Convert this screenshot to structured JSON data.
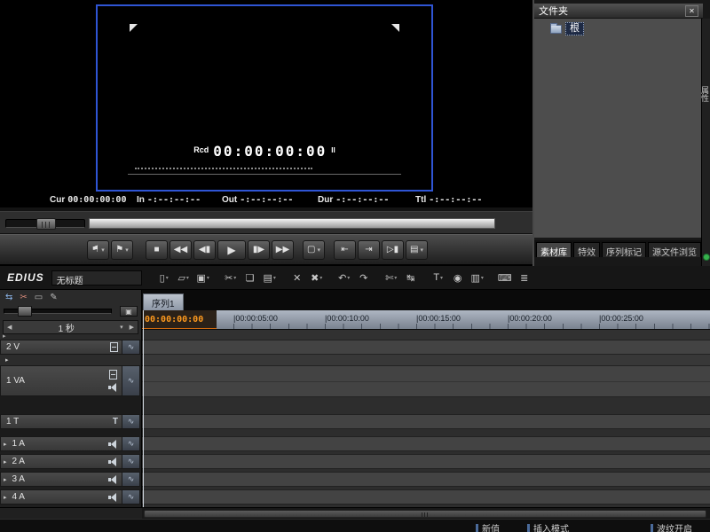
{
  "app": {
    "logo": "EDIUS",
    "project_title": "无标题"
  },
  "ui": {
    "dd": "▾",
    "left_arrow": "◀",
    "right_arrow": "▶",
    "expander": "▸"
  },
  "player": {
    "rcd_label": "Rcd",
    "rcd_timecode": "00:00:00:00",
    "pause_glyph": "II",
    "status": [
      {
        "label": "Cur",
        "value": "00:00:00:00"
      },
      {
        "label": "In",
        "value": "-:--:--:--"
      },
      {
        "label": "Out",
        "value": "-:--:--:--"
      },
      {
        "label": "Dur",
        "value": "-:--:--:--"
      },
      {
        "label": "Ttl",
        "value": "-:--:--:--"
      }
    ]
  },
  "transport": {
    "marker_in_glyph": "⚑",
    "marker_out_glyph": "⚑",
    "stop_glyph": "■",
    "rewind_glyph": "◀◀",
    "prev_frame_glyph": "◀▮",
    "play_glyph": "▶",
    "next_frame_glyph": "▮▶",
    "ffwd_glyph": "▶▶",
    "display_glyph": "▢",
    "goto_in_glyph": "⇤",
    "goto_out_glyph": "⇥",
    "play_around_glyph": "▷▮",
    "export_glyph": "▤"
  },
  "toolbar": {
    "buttons": [
      {
        "name": "new-sequence",
        "glyph": "▯"
      },
      {
        "name": "open-project",
        "glyph": "▱"
      },
      {
        "name": "save-project",
        "glyph": "▣"
      },
      {
        "name": "cut",
        "glyph": "✂"
      },
      {
        "name": "copy",
        "glyph": "❏"
      },
      {
        "name": "paste",
        "glyph": "▤"
      },
      {
        "name": "delete",
        "glyph": "✕"
      },
      {
        "name": "replace",
        "glyph": "✖"
      },
      {
        "name": "undo",
        "glyph": "↶"
      },
      {
        "name": "redo",
        "glyph": "↷"
      },
      {
        "name": "add-cut-point",
        "glyph": "✄"
      },
      {
        "name": "match-frame",
        "glyph": "↹"
      },
      {
        "name": "create-title",
        "glyph": "T"
      },
      {
        "name": "voice-over",
        "glyph": "◉"
      },
      {
        "name": "color-bars",
        "glyph": "▥"
      },
      {
        "name": "keyboard",
        "glyph": "⌨"
      },
      {
        "name": "audio-mixer",
        "glyph": "≣"
      }
    ]
  },
  "mini_toolbar": {
    "icons": [
      {
        "name": "sync-mode",
        "glyph": "⇆"
      },
      {
        "name": "trim-mode",
        "glyph": "✂"
      },
      {
        "name": "select-mode",
        "glyph": "▭"
      },
      {
        "name": "draw-mode",
        "glyph": "✎"
      }
    ],
    "fit_glyph": "▣",
    "zoom_label": "1 秒"
  },
  "timeline": {
    "sequence_tab": "序列1",
    "ruler_current": "00:00:00:00",
    "ruler_marks": [
      "|00:00:05:00",
      "|00:00:10:00",
      "|00:00:15:00",
      "|00:00:20:00",
      "|00:00:25:00"
    ],
    "patch_glyph": "∿",
    "tracks": [
      {
        "label": "2 V"
      },
      {
        "label": "1 VA"
      },
      {
        "label": "1 T"
      },
      {
        "label": "1 A"
      },
      {
        "label": "2 A"
      },
      {
        "label": "3 A"
      },
      {
        "label": "4 A"
      }
    ]
  },
  "bin": {
    "title": "文件夹",
    "close_glyph": "✕",
    "root_label": "根",
    "tabs": [
      "素材库",
      "特效",
      "序列标记",
      "源文件浏览"
    ],
    "side_tab": "属性"
  },
  "statusbar": {
    "items": [
      "新值",
      "插入模式",
      "波纹开启"
    ]
  },
  "colors": {
    "frame_blue": "#2f55d4",
    "timecode_orange": "#ff9a1e",
    "indicator_green": "#37b24d"
  }
}
